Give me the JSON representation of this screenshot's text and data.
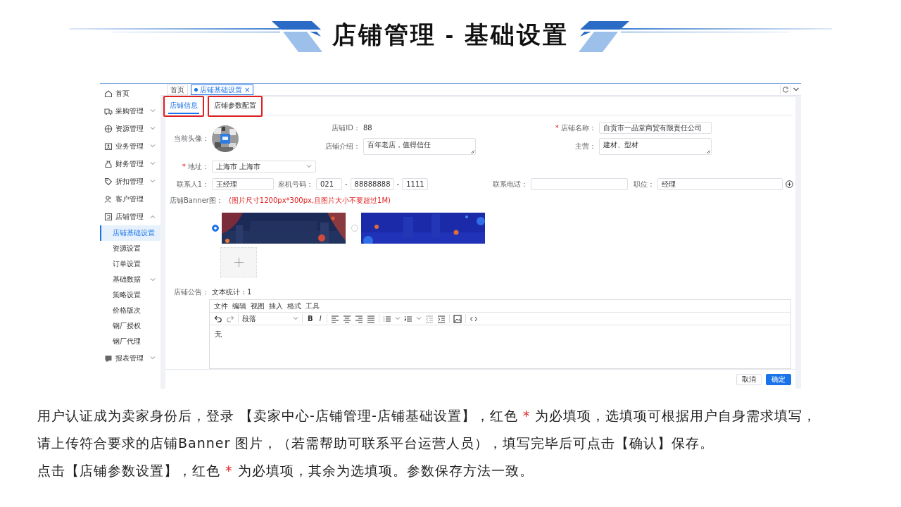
{
  "title": "店铺管理 - 基础设置",
  "app": {
    "page_tabs": [
      {
        "label": "首页",
        "selected": false
      },
      {
        "label": "店铺基础设置",
        "selected": true,
        "close": "×"
      }
    ],
    "sidebar": [
      {
        "label": "首页",
        "kind": "link",
        "selected": false
      },
      {
        "label": "采购管理",
        "kind": "group",
        "expanded": false,
        "selected": false
      },
      {
        "label": "资源管理",
        "kind": "group",
        "expanded": false,
        "selected": false
      },
      {
        "label": "业务管理",
        "kind": "group",
        "expanded": false,
        "selected": false
      },
      {
        "label": "财务管理",
        "kind": "group",
        "expanded": false,
        "selected": false
      },
      {
        "label": "折扣管理",
        "kind": "group",
        "expanded": false,
        "selected": false
      },
      {
        "label": "客户管理",
        "kind": "link",
        "selected": false
      },
      {
        "label": "店铺管理",
        "kind": "group",
        "expanded": true,
        "selected": false,
        "children": [
          {
            "label": "店铺基础设置",
            "kind": "link",
            "selected": true
          },
          {
            "label": "资源设置",
            "kind": "link",
            "selected": false
          },
          {
            "label": "订单设置",
            "kind": "link",
            "selected": false
          },
          {
            "label": "基础数据",
            "kind": "group",
            "expanded": false,
            "selected": false
          },
          {
            "label": "策略设置",
            "kind": "link",
            "selected": false
          },
          {
            "label": "价格版次",
            "kind": "link",
            "selected": false
          },
          {
            "label": "钢厂授权",
            "kind": "link",
            "selected": false
          },
          {
            "label": "钢厂代理",
            "kind": "link",
            "selected": false
          }
        ]
      },
      {
        "label": "报表管理",
        "kind": "group",
        "expanded": false,
        "selected": false
      }
    ],
    "form_tabs": [
      {
        "label": "店铺信息",
        "selected": true,
        "highlighted": true
      },
      {
        "label": "店铺参数配置",
        "selected": false,
        "highlighted": true
      }
    ],
    "form": {
      "avatar": {
        "label": "当前头像：",
        "kind": "picture"
      },
      "store_id": {
        "label": "店铺ID：",
        "value": "88"
      },
      "store_name": {
        "label": "店铺名称：",
        "mark": "*",
        "value": "自贡市一品堂商贸有限责任公司"
      },
      "intro": {
        "label": "店铺介绍：",
        "value": "百年老店，值得信任"
      },
      "main_business": {
        "label": "主营：",
        "value": "建材、型材"
      },
      "address": {
        "label": "地址：",
        "mark": "*",
        "value": "上海市 上海市"
      },
      "contact": {
        "label": "联系人1：",
        "value": "王经理"
      },
      "landline": {
        "label": "座机号码：",
        "parts": [
          "021",
          "88888888",
          "1111"
        ],
        "separators": [
          "-",
          "-"
        ]
      },
      "phone": {
        "label": "联系电话："
      },
      "position": {
        "label": "职位：",
        "value": "经理"
      },
      "banner": {
        "label": "店铺Banner图：",
        "hint": "(图片尺寸1200px*300px,且图片大小不要超过1M)",
        "images": [
          {
            "kind": "picture",
            "selected": true
          },
          {
            "kind": "picture",
            "selected": false
          }
        ]
      },
      "notice": {
        "label": "店铺公告：",
        "counter": "文本统计：1",
        "menu": [
          "文件",
          "编辑",
          "视图",
          "插入",
          "格式",
          "工具"
        ],
        "format": "段落",
        "bold": "B",
        "italic": "I",
        "content": "无"
      }
    },
    "buttons": [
      {
        "label": "取消",
        "kind": "secondary"
      },
      {
        "label": "确定",
        "kind": "primary"
      }
    ]
  },
  "notes": [
    {
      "parts": [
        {
          "kind": "text",
          "text": "用户认证成为卖家身份后，登录 【卖家中心-店铺管理-店铺基础设置】，红色 "
        },
        {
          "kind": "mark",
          "text": "*"
        },
        {
          "kind": "text",
          "text": " 为必填项，选填项可根据用户自身需求填写，"
        }
      ]
    },
    {
      "parts": [
        {
          "kind": "text",
          "text": "请上传符合要求的店铺Banner 图片，（若需帮助可联系平台运营人员），填写完毕后可点击【确认】保存。"
        }
      ]
    },
    {
      "parts": [
        {
          "kind": "text",
          "text": "点击【店铺参数设置】，红色 "
        },
        {
          "kind": "mark",
          "text": "*"
        },
        {
          "kind": "text",
          "text": " 为必填项，其余为选填项。参数保存方法一致。"
        }
      ]
    }
  ]
}
